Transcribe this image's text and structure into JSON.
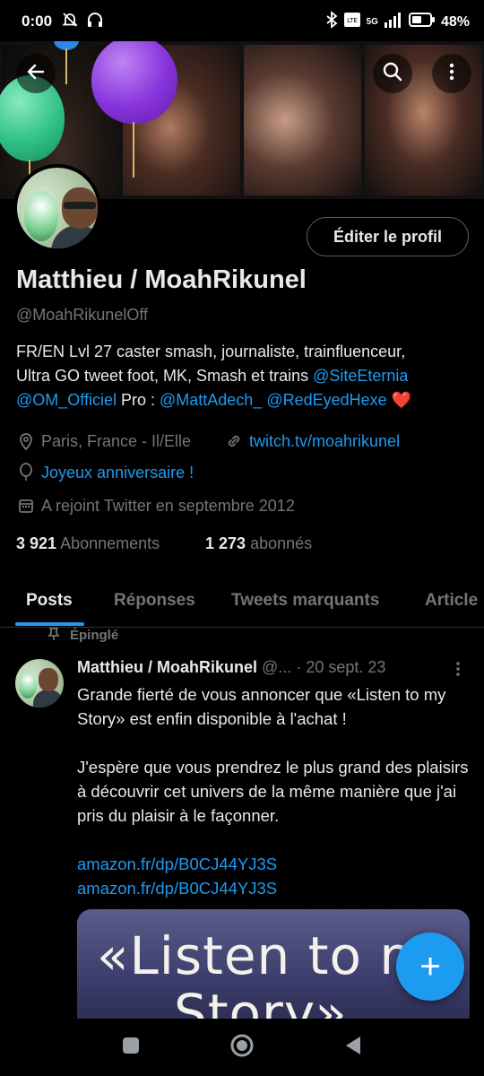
{
  "status_bar": {
    "time": "0:00",
    "network": "5G",
    "battery": "48%"
  },
  "header": {
    "back_icon": "arrow-left-icon",
    "search_icon": "search-icon",
    "more_icon": "more-vertical-icon"
  },
  "profile": {
    "edit_button": "Éditer le profil",
    "name": "Matthieu / MoahRikunel",
    "handle": "@MoahRikunelOff",
    "bio": {
      "line1": "FR/EN Lvl 27 caster smash, journaliste, trainfluenceur,",
      "line2_text": "Ultra GO tweet foot, MK, Smash et trains ",
      "mention_eternia": "@SiteEternia",
      "mention_om": "@OM_Officiel",
      "pro_text": " Pro : ",
      "mention_matt": "@MattAdech_",
      "mention_hexe": "@RedEyedHexe",
      "heart": "❤️"
    },
    "location": "Paris, France - Il/Elle",
    "website": "twitch.tv/moahrikunel",
    "birthday": "Joyeux anniversaire !",
    "joined": "A rejoint Twitter en septembre 2012",
    "following_count": "3 921",
    "following_label": "Abonnements",
    "followers_count": "1 273",
    "followers_label": "abonnés"
  },
  "tabs": [
    {
      "label": "Posts",
      "active": true
    },
    {
      "label": "Réponses",
      "active": false
    },
    {
      "label": "Tweets marquants",
      "active": false
    },
    {
      "label": "Article",
      "active": false
    }
  ],
  "post": {
    "pinned_label": "Épinglé",
    "author_name": "Matthieu / MoahRikunel",
    "author_handle_truncated": "@...",
    "date": "· 20 sept. 23",
    "paragraph1": "Grande fierté de vous annoncer que «Listen to my Story» est enfin disponible à l'achat !",
    "paragraph2": "J'espère que vous prendrez le plus grand des plaisirs à découvrir cet univers de la même manière que j'ai pris du plaisir à le façonner.",
    "link1": "amazon.fr/dp/B0CJ44YJ3S",
    "link2": "amazon.fr/dp/B0CJ44YJ3S",
    "media_title_line1": "«Listen to m",
    "media_title_line2": "Story»"
  },
  "fab": {
    "label": "+"
  }
}
